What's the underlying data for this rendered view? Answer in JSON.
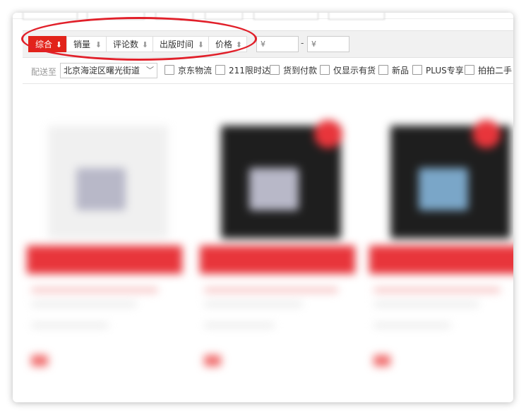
{
  "sort_bar": {
    "buttons": [
      {
        "label": "综合",
        "arrow": "⬇",
        "active": true
      },
      {
        "label": "销量",
        "arrow": "⬇",
        "active": false
      },
      {
        "label": "评论数",
        "arrow": "⬇",
        "active": false
      },
      {
        "label": "出版时间",
        "arrow": "⬇",
        "active": false
      },
      {
        "label": "价格",
        "arrow": "⬍",
        "active": false
      }
    ],
    "price_min_placeholder": "¥",
    "price_max_placeholder": "¥",
    "price_separator": "-"
  },
  "filter_row": {
    "deliver_label": "配送至",
    "region_value": "北京海淀区曙光街道",
    "checkboxes": [
      "京东物流",
      "211限时达",
      "货到付款",
      "仅显示有货",
      "新品",
      "PLUS专享",
      "拍拍二手"
    ]
  },
  "colors": {
    "accent": "#e2231a",
    "highlight_ellipse": "#e1202a"
  }
}
